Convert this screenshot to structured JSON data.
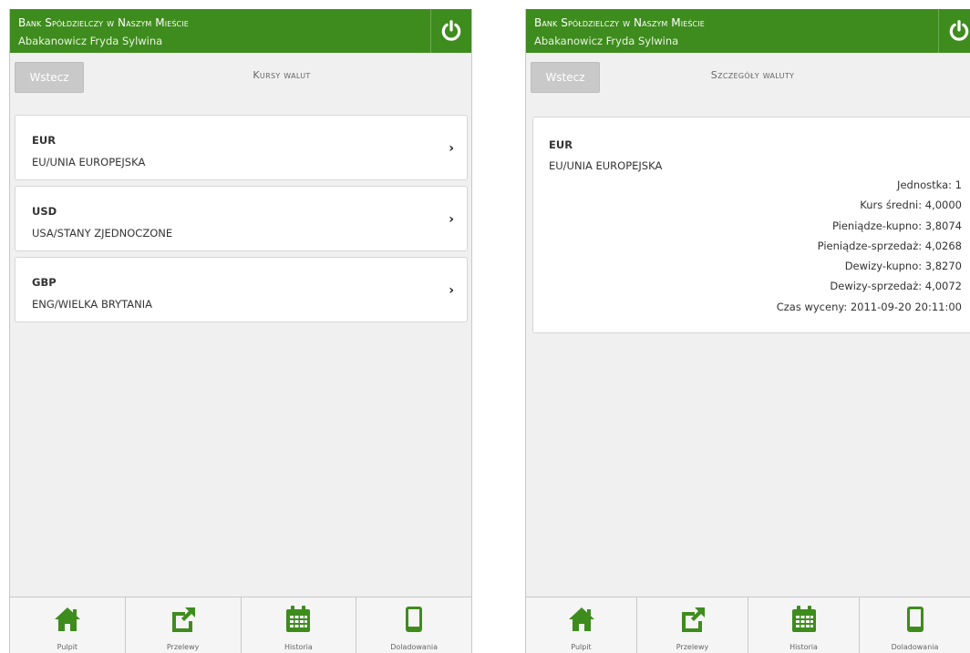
{
  "header": {
    "bank_name": "Bank Spółdzielczy w Naszym Mieście",
    "user_name": "Abakanowicz Fryda Sylwina"
  },
  "left_screen": {
    "back_label": "Wstecz",
    "title": "Kursy walut",
    "currencies": [
      {
        "code": "EUR",
        "name": "EU/UNIA EUROPEJSKA"
      },
      {
        "code": "USD",
        "name": "USA/STANY ZJEDNOCZONE"
      },
      {
        "code": "GBP",
        "name": "ENG/WIELKA BRYTANIA"
      }
    ]
  },
  "right_screen": {
    "back_label": "Wstecz",
    "title": "Szczegóły waluty",
    "currency": {
      "code": "EUR",
      "name": "EU/UNIA EUROPEJSKA"
    },
    "details": [
      "Jednostka: 1",
      "Kurs średni: 4,0000",
      "Pieniądze-kupno: 3,8074",
      "Pieniądze-sprzedaż: 4,0268",
      "Dewizy-kupno: 3,8270",
      "Dewizy-sprzedaż: 4,0072",
      "Czas wyceny: 2011-09-20 20:11:00"
    ]
  },
  "nav": [
    {
      "label": "Pulpit",
      "icon": "home-icon"
    },
    {
      "label": "Przelewy",
      "icon": "transfer-icon"
    },
    {
      "label": "Historia",
      "icon": "calendar-icon"
    },
    {
      "label": "Doladowania",
      "icon": "phone-icon"
    }
  ],
  "colors": {
    "brand_green": "#3e8c1d",
    "background": "#f0f0f0"
  }
}
